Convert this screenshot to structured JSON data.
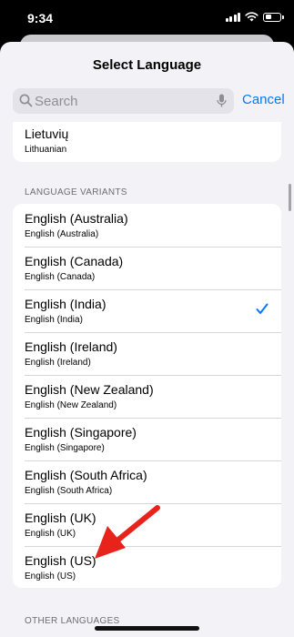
{
  "status_bar": {
    "time": "9:34"
  },
  "sheet": {
    "title": "Select Language"
  },
  "search": {
    "placeholder": "Search",
    "cancel_label": "Cancel"
  },
  "top_item": {
    "native": "Lietuvių",
    "english": "Lithuanian"
  },
  "variants_header": "LANGUAGE VARIANTS",
  "variants": [
    {
      "native": "English (Australia)",
      "english": "English (Australia)",
      "selected": false
    },
    {
      "native": "English (Canada)",
      "english": "English (Canada)",
      "selected": false
    },
    {
      "native": "English (India)",
      "english": "English (India)",
      "selected": true
    },
    {
      "native": "English (Ireland)",
      "english": "English (Ireland)",
      "selected": false
    },
    {
      "native": "English (New Zealand)",
      "english": "English (New Zealand)",
      "selected": false
    },
    {
      "native": "English (Singapore)",
      "english": "English (Singapore)",
      "selected": false
    },
    {
      "native": "English (South Africa)",
      "english": "English (South Africa)",
      "selected": false
    },
    {
      "native": "English (UK)",
      "english": "English (UK)",
      "selected": false
    },
    {
      "native": "English (US)",
      "english": "English (US)",
      "selected": false
    }
  ],
  "other_header": "OTHER LANGUAGES",
  "colors": {
    "accent": "#007aff",
    "annotation": "#e8231c"
  },
  "icons": {
    "search": "search-icon",
    "mic": "microphone-icon",
    "check": "checkmark-icon",
    "signal": "cellular-signal-icon",
    "wifi": "wifi-icon",
    "battery": "battery-icon"
  }
}
